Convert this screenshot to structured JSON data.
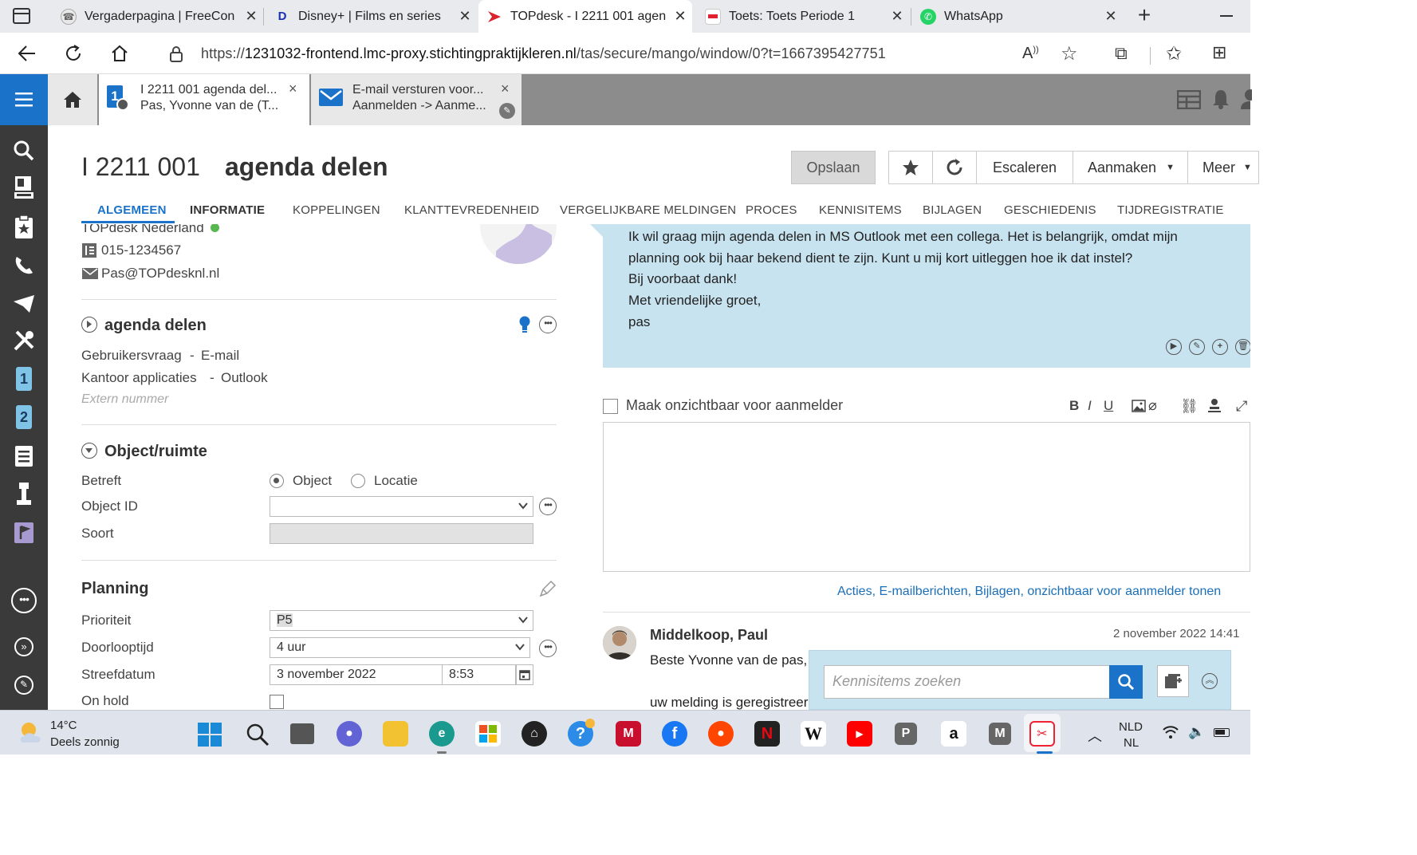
{
  "browser": {
    "tabs": [
      {
        "title": "Vergaderpagina | FreeCon",
        "icon": "freeconference-icon"
      },
      {
        "title": "Disney+ | Films en series",
        "icon": "disney-icon"
      },
      {
        "title": "TOPdesk - I 2211 001 agen",
        "icon": "topdesk-icon"
      },
      {
        "title": "Toets: Toets Periode 1",
        "icon": "toets-icon"
      },
      {
        "title": "WhatsApp",
        "icon": "whatsapp-icon"
      }
    ],
    "url_prefix": "https://",
    "url_host": "1231032-frontend.lmc-proxy.stichtingpraktijkleren.nl",
    "url_path": "/tas/secure/mango/window/0?t=1667395427751"
  },
  "app_tabs": [
    {
      "line1": "I 2211 001 agenda del...",
      "line2": "Pas, Yvonne van de (T...",
      "close": "×"
    },
    {
      "line1": "E-mail versturen voor...",
      "line2": "Aanmelden -> Aanme...",
      "close": "×"
    }
  ],
  "header": {
    "number": "I 2211 001",
    "title": "agenda delen",
    "save_label": "Opslaan",
    "escalate_label": "Escaleren",
    "create_label": "Aanmaken",
    "more_label": "Meer"
  },
  "subtabs": [
    "ALGEMEEN",
    "INFORMATIE",
    "KOPPELINGEN",
    "KLANTTEVREDENHEID",
    "VERGELIJKBARE MELDINGEN",
    "PROCES",
    "KENNISITEMS",
    "BIJLAGEN",
    "GESCHIEDENIS",
    "TIJDREGISTRATIE"
  ],
  "caller": {
    "org": "TOPdesk Nederland",
    "phone": "015-1234567",
    "email": "Pas@TOPdesknl.nl"
  },
  "request": {
    "title": "agenda delen",
    "category": "Gebruikersvraag",
    "subcategory": "E-mail",
    "cat2": "Kantoor applicaties",
    "subcat2": "Outlook",
    "external_placeholder": "Extern nummer"
  },
  "object": {
    "title": "Object/ruimte",
    "concerns_label": "Betreft",
    "opt_object": "Object",
    "opt_location": "Locatie",
    "objectid_label": "Object ID",
    "type_label": "Soort"
  },
  "planning": {
    "title": "Planning",
    "priority_label": "Prioriteit",
    "priority_value": "P5",
    "duration_label": "Doorlooptijd",
    "duration_value": "4 uur",
    "target_label": "Streefdatum",
    "target_date": "3 november 2022",
    "target_time": "8:53",
    "onhold_label": "On hold"
  },
  "message": {
    "lines": [
      "Ik wil graag mijn agenda delen in MS Outlook met een collega. Het is belangrijk, omdat mijn",
      "planning ook bij haar bekend dient te zijn. Kunt u mij kort uitleggen hoe ik dat instel?",
      "Bij voorbaat dank!",
      "Met vriendelijke groet,",
      "pas"
    ]
  },
  "editor": {
    "invisible_label": "Maak onzichtbaar voor aanmelder",
    "show_link": "Acties, E-mailberichten, Bijlagen, onzichtbaar voor aanmelder tonen"
  },
  "reply": {
    "author": "Middelkoop, Paul",
    "date": "2 november 2022 14:41",
    "line1": "Beste Yvonne van de pas,",
    "line2": "uw melding is geregistreerd"
  },
  "kb": {
    "placeholder": "Kennisitems zoeken"
  },
  "taskbar": {
    "temp": "14°C",
    "weather": "Deels zonnig",
    "lang1": "NLD",
    "lang2": "NL"
  },
  "colors": {
    "accent": "#1a73c8",
    "bubble": "#c8e3f0",
    "sidebar": "#3a3a3a"
  }
}
